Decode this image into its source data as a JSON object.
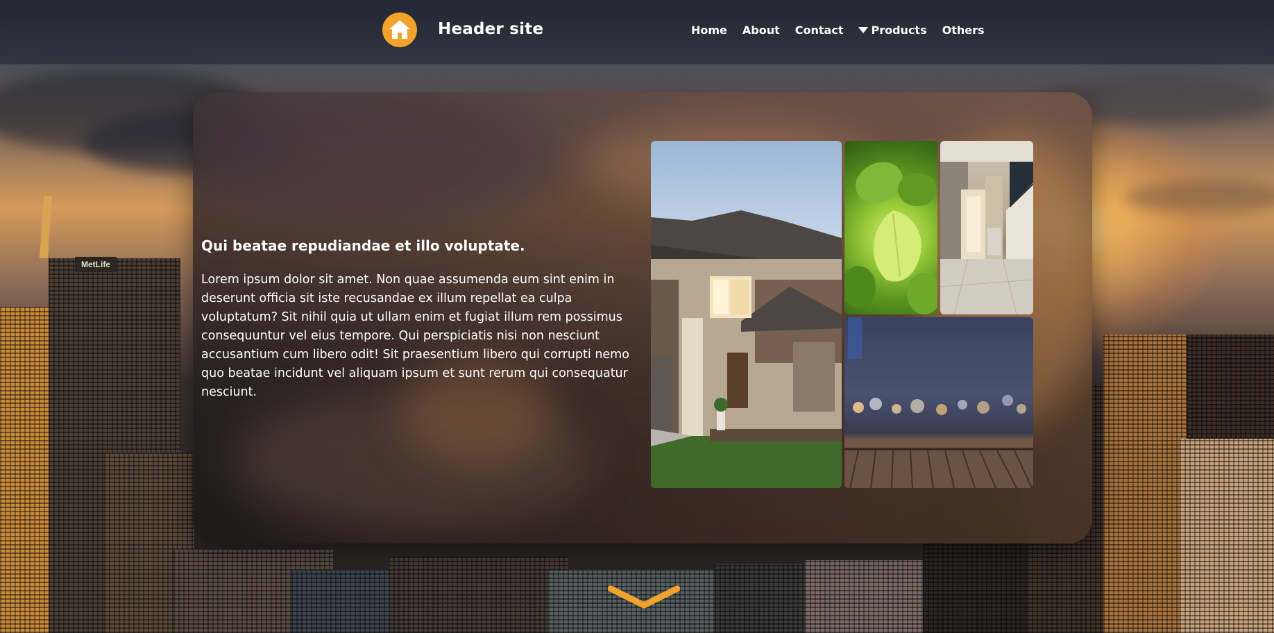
{
  "header": {
    "logo_icon": "home-icon",
    "site_title": "Header site",
    "nav": {
      "home": "Home",
      "about": "About",
      "contact": "Contact",
      "products": "Products",
      "others": "Others"
    }
  },
  "main": {
    "headline": "Qui beatae repudiandae et illo voluptate.",
    "paragraph": "Lorem ipsum dolor sit amet. Non quae assumenda eum sint enim in deserunt officia sit iste recusandae ex illum repellat ea culpa voluptatum? Sit nihil quia ut ullam enim et fugiat illum rem possimus consequuntur vel eius tempore. Qui perspiciatis nisi non nesciunt accusantium cum libero odit! Sit praesentium libero qui corrupti nemo quo beatae incidunt vel aliquam ipsum et sunt rerum qui consequatur nesciunt.",
    "gallery": [
      {
        "name": "house-photo"
      },
      {
        "name": "leaf-photo"
      },
      {
        "name": "hallway-photo"
      },
      {
        "name": "night-bokeh-photo"
      }
    ]
  },
  "scroll_indicator": {
    "icon": "chevron-down-icon"
  },
  "colors": {
    "accent": "#f2a32c",
    "header_bg": "rgba(22,24,34,0.45)",
    "text": "#ffffff"
  }
}
